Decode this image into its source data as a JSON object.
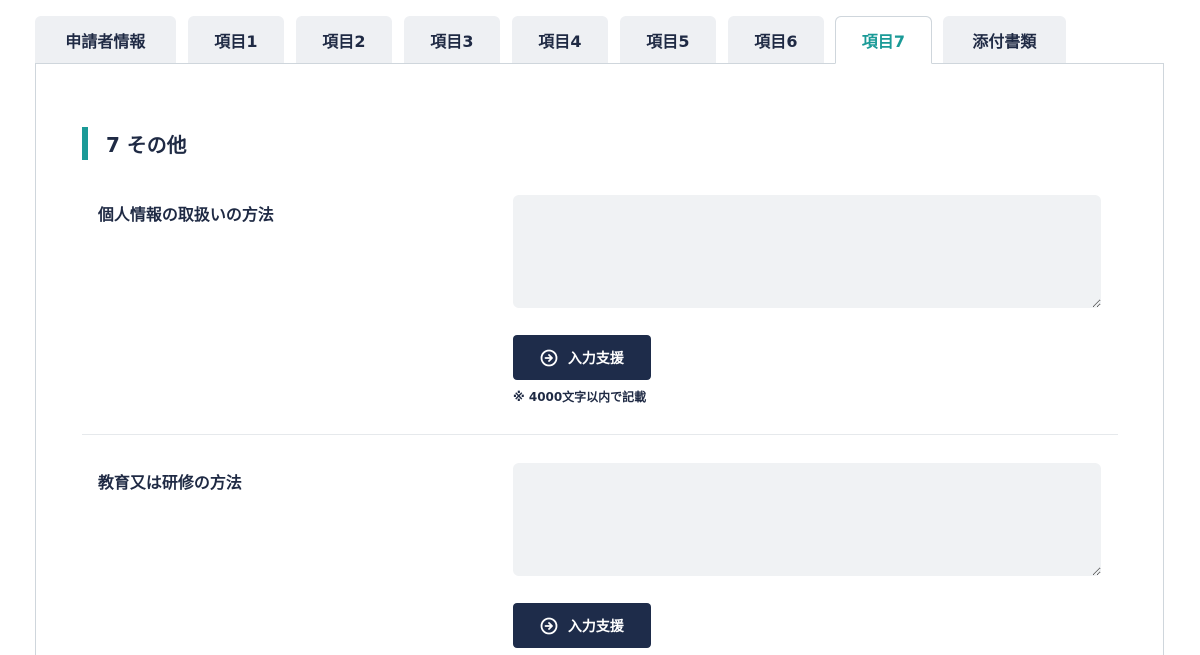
{
  "tabs": [
    {
      "label": "申請者情報",
      "active": false
    },
    {
      "label": "項目1",
      "active": false
    },
    {
      "label": "項目2",
      "active": false
    },
    {
      "label": "項目3",
      "active": false
    },
    {
      "label": "項目4",
      "active": false
    },
    {
      "label": "項目5",
      "active": false
    },
    {
      "label": "項目6",
      "active": false
    },
    {
      "label": "項目7",
      "active": true
    },
    {
      "label": "添付書類",
      "active": false
    }
  ],
  "section": {
    "title": "7 その他"
  },
  "fields": [
    {
      "label": "個人情報の取扱いの方法",
      "value": "",
      "assist_label": "入力支援",
      "note": "※ 4000文字以内で記載"
    },
    {
      "label": "教育又は研修の方法",
      "value": "",
      "assist_label": "入力支援"
    }
  ],
  "colors": {
    "accent": "#1a9a97",
    "button_bg": "#1e2c4a",
    "text": "#1f2a44",
    "input_bg": "#f0f2f4"
  },
  "icons": {
    "assist_button": "arrow-right-circle-icon"
  }
}
